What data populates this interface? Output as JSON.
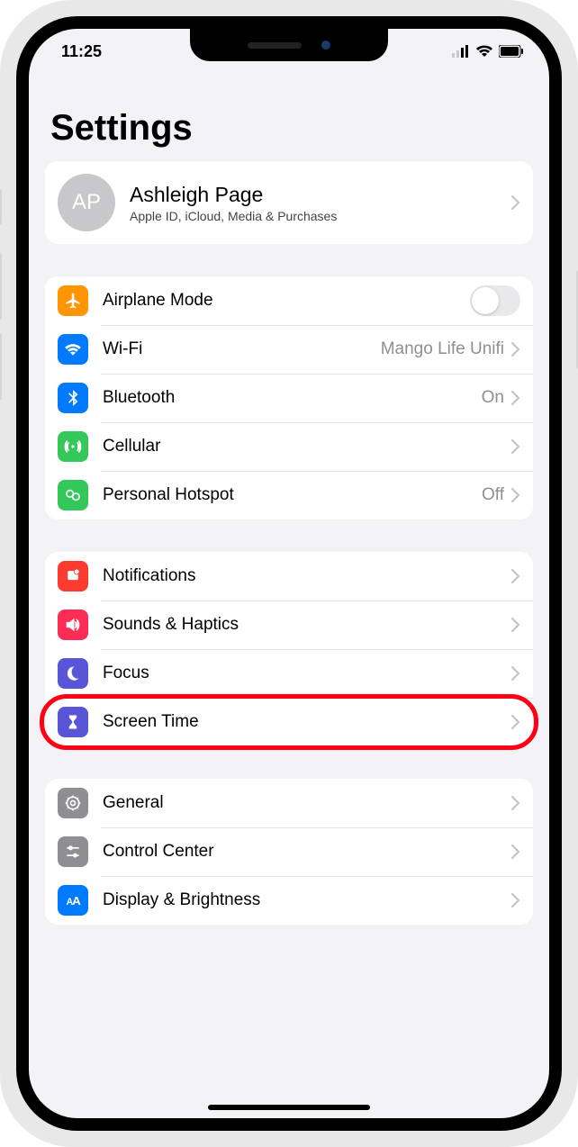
{
  "status": {
    "time": "11:25"
  },
  "page": {
    "title": "Settings"
  },
  "profile": {
    "initials": "AP",
    "name": "Ashleigh Page",
    "subtitle": "Apple ID, iCloud, Media & Purchases"
  },
  "groups": [
    {
      "rows": [
        {
          "id": "airplane",
          "label": "Airplane Mode",
          "icon": "airplane",
          "color": "#ff9500",
          "type": "toggle",
          "value": false
        },
        {
          "id": "wifi",
          "label": "Wi-Fi",
          "icon": "wifi",
          "color": "#007aff",
          "type": "link",
          "detail": "Mango Life Unifi"
        },
        {
          "id": "bluetooth",
          "label": "Bluetooth",
          "icon": "bluetooth",
          "color": "#007aff",
          "type": "link",
          "detail": "On"
        },
        {
          "id": "cellular",
          "label": "Cellular",
          "icon": "cellular",
          "color": "#34c759",
          "type": "link",
          "detail": ""
        },
        {
          "id": "hotspot",
          "label": "Personal Hotspot",
          "icon": "hotspot",
          "color": "#34c759",
          "type": "link",
          "detail": "Off"
        }
      ]
    },
    {
      "rows": [
        {
          "id": "notifications",
          "label": "Notifications",
          "icon": "bell",
          "color": "#ff3b30",
          "type": "link",
          "detail": ""
        },
        {
          "id": "sounds",
          "label": "Sounds & Haptics",
          "icon": "speaker",
          "color": "#ff2d55",
          "type": "link",
          "detail": ""
        },
        {
          "id": "focus",
          "label": "Focus",
          "icon": "moon",
          "color": "#5856d6",
          "type": "link",
          "detail": ""
        },
        {
          "id": "screentime",
          "label": "Screen Time",
          "icon": "hourglass",
          "color": "#5856d6",
          "type": "link",
          "detail": "",
          "highlighted": true
        }
      ]
    },
    {
      "rows": [
        {
          "id": "general",
          "label": "General",
          "icon": "gear",
          "color": "#8e8e93",
          "type": "link",
          "detail": ""
        },
        {
          "id": "controlcenter",
          "label": "Control Center",
          "icon": "sliders",
          "color": "#8e8e93",
          "type": "link",
          "detail": ""
        },
        {
          "id": "display",
          "label": "Display & Brightness",
          "icon": "text",
          "color": "#007aff",
          "type": "link",
          "detail": ""
        }
      ]
    }
  ],
  "highlight": {
    "target": "screentime"
  }
}
